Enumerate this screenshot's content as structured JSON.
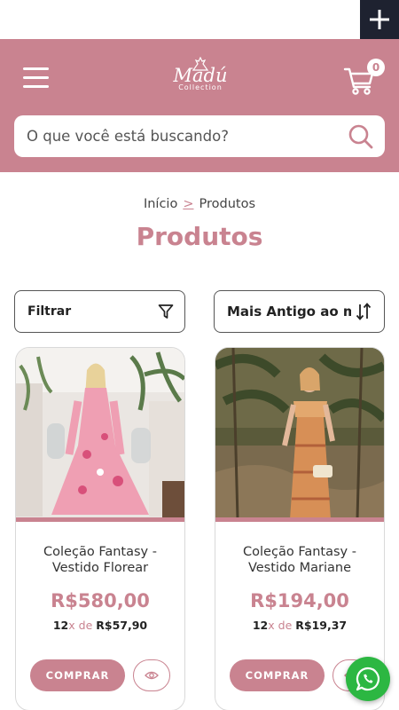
{
  "colors": {
    "brand": "#c98390",
    "dark": "#1e2230",
    "whatsapp": "#2cb742"
  },
  "header": {
    "logo_text": "Madú",
    "logo_sub": "Collection",
    "cart_count": "0"
  },
  "search": {
    "placeholder": "O que você está buscando?"
  },
  "breadcrumb": {
    "home": "Início",
    "separator": ">",
    "current": "Produtos"
  },
  "page_title": "Produtos",
  "toolbar": {
    "filter_label": "Filtrar",
    "sort_label": "Mais Antigo ao mais Novo"
  },
  "products": [
    {
      "name": "Coleção Fantasy - Vestido Florear",
      "price": "R$580,00",
      "installments": "12",
      "installment_mid": "x de ",
      "installment_value": "R$57,90",
      "buy_label": "COMPRAR"
    },
    {
      "name": "Coleção Fantasy - Vestido Mariane",
      "price": "R$194,00",
      "installments": "12",
      "installment_mid": "x de ",
      "installment_value": "R$19,37",
      "buy_label": "COMPRAR"
    }
  ]
}
